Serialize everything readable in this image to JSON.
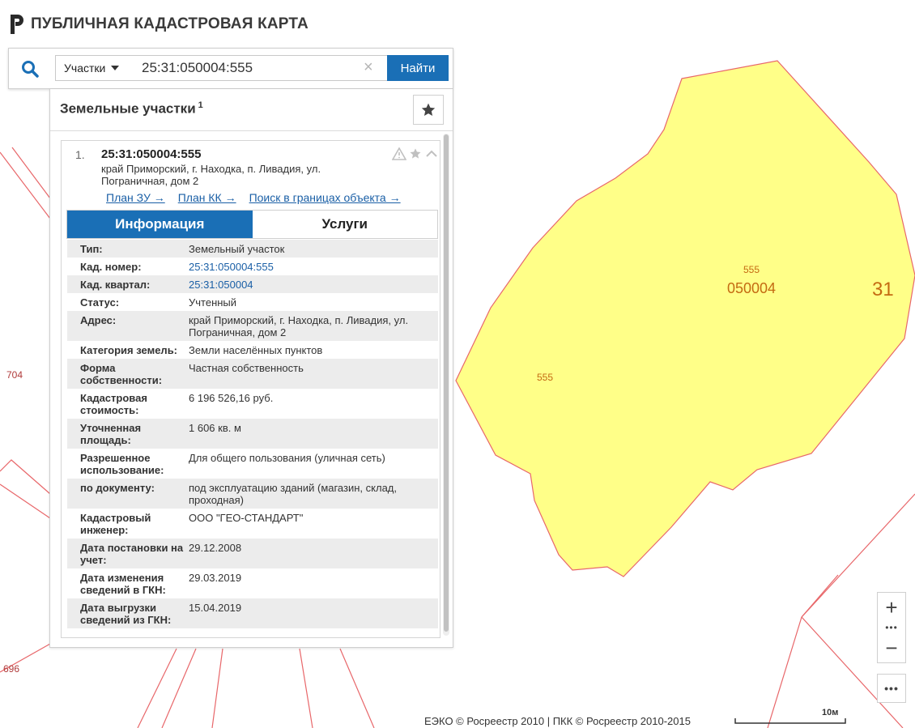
{
  "app": {
    "title": "ПУБЛИЧНАЯ КАДАСТРОВАЯ КАРТА"
  },
  "search": {
    "type_label": "Участки",
    "query": "25:31:050004:555",
    "find_label": "Найти"
  },
  "panel": {
    "title": "Земельные участки",
    "count": "1"
  },
  "result": {
    "number": "1.",
    "cad_number": "25:31:050004:555",
    "address": "край Приморский, г. Находка, п. Ливадия, ул. Пограничная, дом 2",
    "links": [
      "План ЗУ →",
      "План КК →",
      "Поиск в границах объекта →"
    ],
    "tabs": [
      "Информация",
      "Услуги"
    ],
    "info": [
      {
        "k": "Тип:",
        "v": "Земельный участок"
      },
      {
        "k": "Кад. номер:",
        "v": "25:31:050004:555",
        "link": true
      },
      {
        "k": "Кад. квартал:",
        "v": "25:31:050004",
        "link": true
      },
      {
        "k": "Статус:",
        "v": "Учтенный"
      },
      {
        "k": "Адрес:",
        "v": "край Приморский, г. Находка, п. Ливадия, ул. Пограничная, дом 2"
      },
      {
        "k": "Категория земель:",
        "v": "Земли населённых пунктов"
      },
      {
        "k": "Форма собственности:",
        "v": "Частная собственность"
      },
      {
        "k": "Кадастровая стоимость:",
        "v": "6 196 526,16 руб."
      },
      {
        "k": "Уточненная площадь:",
        "v": "1 606 кв. м"
      },
      {
        "k": "Разрешенное использование:",
        "v": "Для общего пользования (уличная сеть)"
      },
      {
        "k": "по документу:",
        "v": "под эксплуатацию зданий (магазин, склад, проходная)"
      },
      {
        "k": "Кадастровый инженер:",
        "v": "ООО \"ГЕО-СТАНДАРТ\""
      },
      {
        "k": "Дата постановки на учет:",
        "v": "29.12.2008"
      },
      {
        "k": "Дата изменения сведений в ГКН:",
        "v": "29.03.2019"
      },
      {
        "k": "Дата выгрузки сведений из ГКН:",
        "v": "15.04.2019"
      }
    ]
  },
  "map": {
    "labels": {
      "parcel_a": "555",
      "block": "050004",
      "district": "31",
      "parcel_b": "555",
      "left_a": "704",
      "left_b": "696"
    },
    "colors": {
      "parcel_fill": "#ffff88",
      "boundary": "#e8676a",
      "label": "#c46a12"
    }
  },
  "controls": {
    "zoom_in": "+",
    "zoom_mid": "•••",
    "zoom_out": "−",
    "more": "•••"
  },
  "footer": {
    "copyright": "ЕЭКО © Росреестр 2010 | ПКК © Росреестр 2010-2015",
    "scale": "10м"
  }
}
